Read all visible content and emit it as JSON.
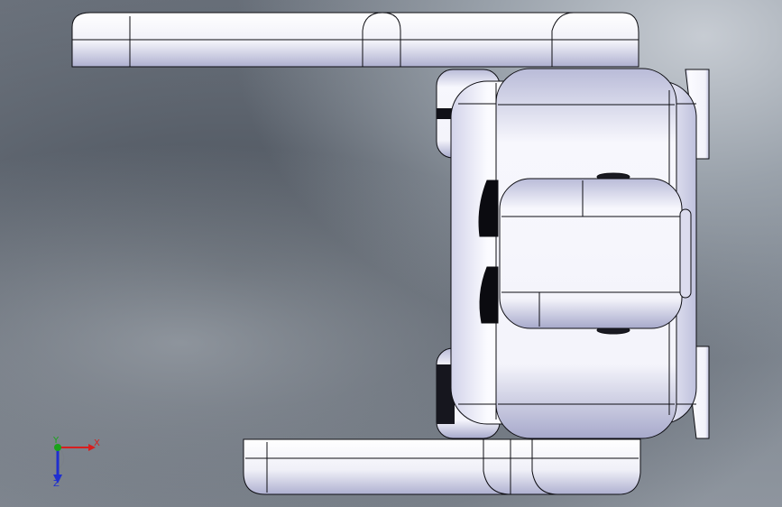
{
  "viewport": {
    "background": "gradient-gray"
  },
  "model": {
    "part_color": "#f2f2fb",
    "edge_color": "#0d0d12",
    "shadow_color": "#9a9cc2"
  },
  "triad": {
    "x_label": "X",
    "y_label": "Y",
    "z_label": "Z",
    "x_color": "#d81e1e",
    "y_color": "#1aa31a",
    "z_color": "#1f2fd0"
  }
}
